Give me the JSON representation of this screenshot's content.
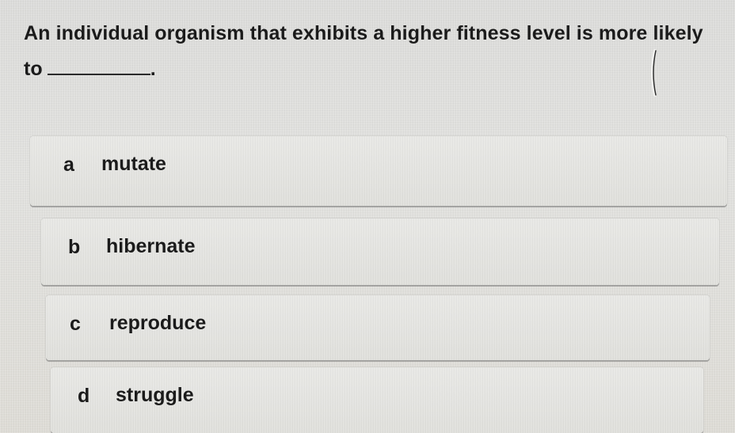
{
  "question": {
    "text": "An individual organism that exhibits a higher fitness level is more likely to",
    "end_punct": "."
  },
  "options": [
    {
      "letter": "a",
      "text": "mutate"
    },
    {
      "letter": "b",
      "text": "hibernate"
    },
    {
      "letter": "c",
      "text": "reproduce"
    },
    {
      "letter": "d",
      "text": "struggle"
    }
  ]
}
